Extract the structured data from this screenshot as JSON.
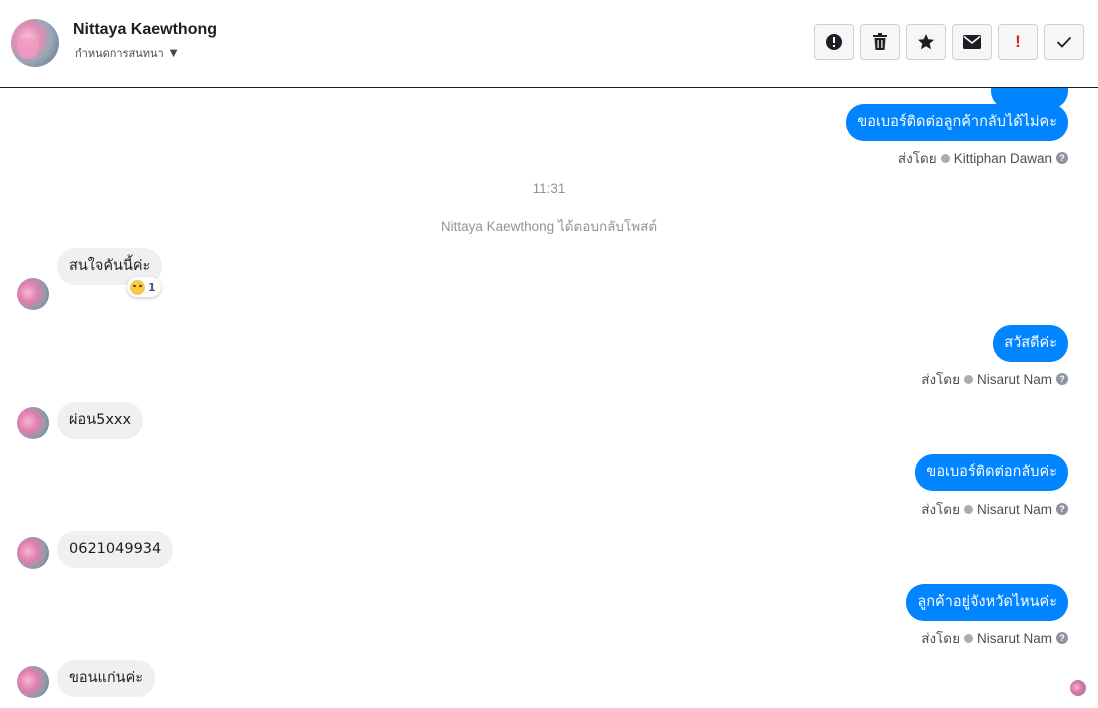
{
  "header": {
    "name": "Nittaya Kaewthong",
    "status": "กำหนดการสนทนา",
    "actions": [
      {
        "icon": "alert-circle-icon",
        "label": "!"
      },
      {
        "icon": "trash-icon"
      },
      {
        "icon": "star-icon"
      },
      {
        "icon": "envelope-icon"
      },
      {
        "icon": "exclamation-icon",
        "label": "!"
      },
      {
        "icon": "check-icon"
      }
    ]
  },
  "thread": {
    "m1": {
      "text": "ขอเบอร์ติดต่อลูกค้ากลับได้ไม่คะ",
      "sent_by_prefix": "ส่งโดย",
      "sender": "Kittiphan Dawan"
    },
    "time": "11:31",
    "event": "Nittaya Kaewthong ได้ตอบกลับโพสต์",
    "m2": {
      "text": "สนใจคันนี้ค่ะ",
      "reaction_count": "1"
    },
    "m3": {
      "text": "สวัสดีค่ะ",
      "sent_by_prefix": "ส่งโดย",
      "sender": "Nisarut Nam"
    },
    "m4": {
      "text": "ผ่อน5xxx"
    },
    "m5": {
      "text": "ขอเบอร์ติดต่อกลับค่ะ",
      "sent_by_prefix": "ส่งโดย",
      "sender": "Nisarut Nam"
    },
    "m6": {
      "text": "0621049934"
    },
    "m7": {
      "text": "ลูกค้าอยู่จังหวัดไหนค่ะ",
      "sent_by_prefix": "ส่งโดย",
      "sender": "Nisarut Nam"
    },
    "m8": {
      "text": "ขอนแก่นค่ะ"
    }
  },
  "colors": {
    "outgoing_bubble": "#0084ff",
    "incoming_bubble": "#f1f0f0",
    "alert_red": "#e02020"
  }
}
